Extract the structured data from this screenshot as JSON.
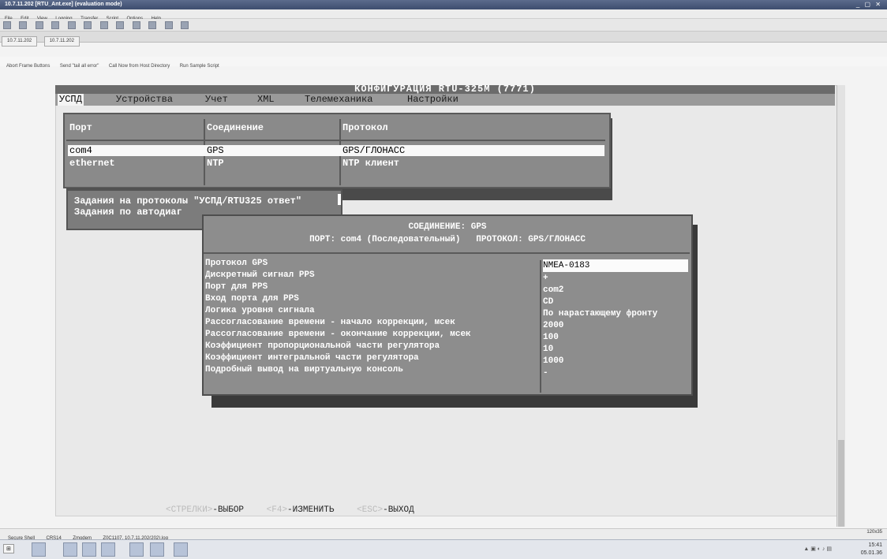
{
  "window": {
    "title": "10.7.11.202 [RTU_Ant.exe] (evaluation mode)",
    "controls": "_ ▢ ✕"
  },
  "menubar": [
    "File",
    "Edit",
    "View",
    "Logging",
    "Transfer",
    "Script",
    "Options",
    "Help"
  ],
  "session_tabs": [
    "10.7.11.202",
    "10.7.11.202"
  ],
  "quickbar": [
    "Abort Frame Buttons",
    "Send \"tail all error\"",
    "Call Now from Host Directory",
    "Run Sample Script"
  ],
  "terminal": {
    "title": "КОНФИГУРАЦИЯ RTU-325M (7771)",
    "menu": [
      "УСПД",
      "Устройства",
      "Учет",
      "XML",
      "Телемеханика",
      "Настройки"
    ],
    "menu_selected": 0,
    "ports": {
      "headers": [
        "Порт",
        "Соединение",
        "Протокол"
      ],
      "rows": [
        [
          "com4",
          "GPS",
          "GPS/ГЛОНАСС"
        ],
        [
          "ethernet",
          "NTP",
          "NTP клиент"
        ]
      ]
    },
    "tasks": [
      "Задания на протоколы \"УСПД/RTU325 ответ\"",
      "Задания по автодиаг"
    ],
    "dialog": {
      "title": "СОЕДИНЕНИЕ: GPS",
      "subtitle": "ПОРТ: com4 (Последовательный)   ПРОТОКОЛ: GPS/ГЛОНАСС",
      "params": [
        {
          "name": "Протокол GPS",
          "value": "NMEA-0183"
        },
        {
          "name": "Дискретный сигнал PPS",
          "value": "+"
        },
        {
          "name": "Порт для PPS",
          "value": "com2"
        },
        {
          "name": "Вход порта для PPS",
          "value": "CD"
        },
        {
          "name": "Логика уровня сигнала",
          "value": "По нарастающему фронту"
        },
        {
          "name": "Рассогласование времени - начало коррекции, мсек",
          "value": "2000"
        },
        {
          "name": "Рассогласование времени - окончание коррекции, мсек",
          "value": "100"
        },
        {
          "name": "Коэффициент пропорциональной части регулятора",
          "value": "10"
        },
        {
          "name": "Коэффициент интегральной части регулятора",
          "value": "1000"
        },
        {
          "name": "Подробный вывод на виртуальную консоль",
          "value": "-"
        }
      ]
    },
    "hints": {
      "select_key": "<СТРЕЛКИ>",
      "select_label": "-ВЫБОР",
      "edit_key": "<F4>",
      "edit_label": "-ИЗМЕНИТЬ",
      "exit_key": "<ESC>",
      "exit_label": "-ВЫХОД"
    }
  },
  "statusbar": [
    "Secure Shell",
    "CRS14",
    "Zmodem",
    "Z0C1107, 10.7.11.202(202).log"
  ],
  "tray": {
    "time": "15:41",
    "date": "05.01.36",
    "size": "120x35"
  }
}
